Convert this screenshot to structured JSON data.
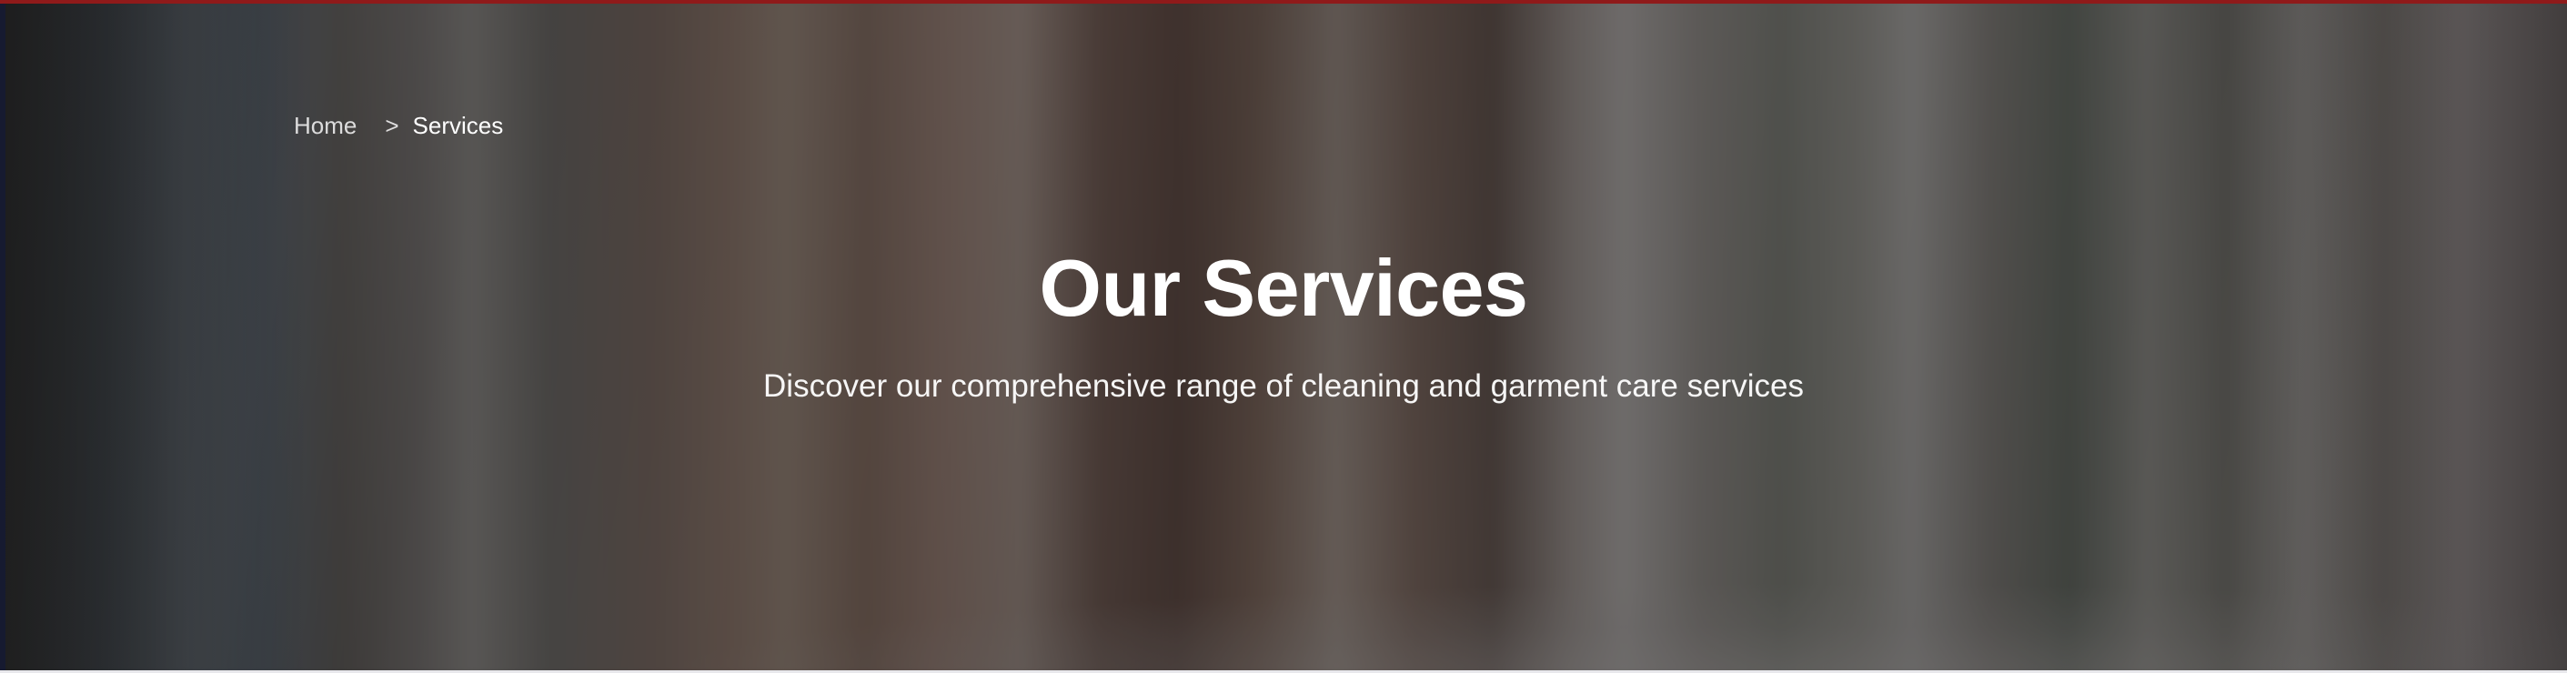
{
  "breadcrumb": {
    "home_label": "Home",
    "separator": ">",
    "current_label": "Services"
  },
  "hero": {
    "title": "Our Services",
    "subtitle": "Discover our comprehensive range of cleaning and garment care services"
  },
  "colors": {
    "accent_bar": "#8f1a1a",
    "overlay": "#161618",
    "text": "#ffffff"
  }
}
